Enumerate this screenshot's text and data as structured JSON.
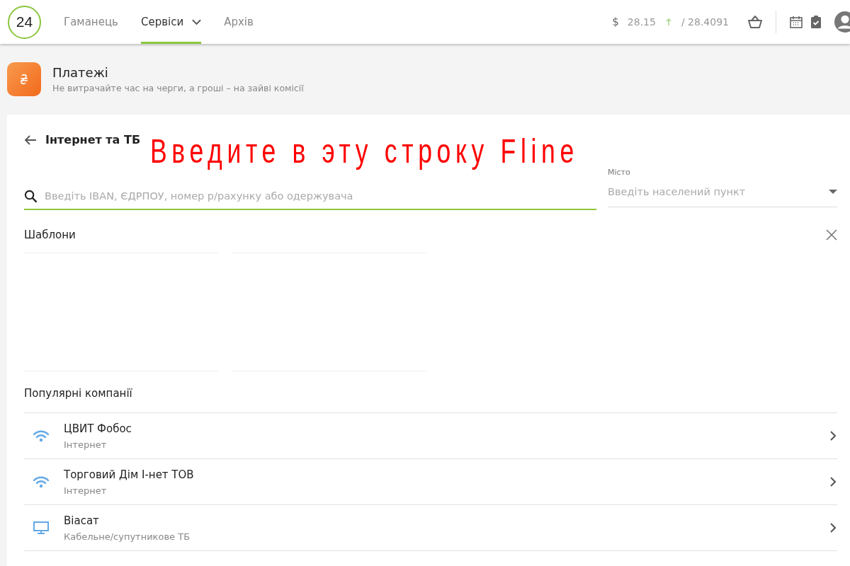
{
  "header": {
    "logo": "24",
    "nav": [
      {
        "label": "Гаманець",
        "selected": false,
        "dropdown": false
      },
      {
        "label": "Сервіси",
        "selected": true,
        "dropdown": true
      },
      {
        "label": "Архів",
        "selected": false,
        "dropdown": false
      }
    ],
    "currency": "$",
    "rate_buy": "28.15",
    "rate_sell": "/ 28.4091"
  },
  "section": {
    "title": "Платежі",
    "subtitle": "Не витрачайте час на черги, а гроші – на зайві комісії"
  },
  "annotation": "Введите в эту строку Fline",
  "page": {
    "title": "Інтернет та ТБ",
    "search": {
      "placeholder": "Введіть IBAN, ЄДРПОУ, номер р/рахунку або одержувача"
    },
    "city": {
      "label": "Місто",
      "placeholder": "Введіть населений пункт"
    }
  },
  "templates": {
    "title": "Шаблони"
  },
  "companies": {
    "title": "Популярні компанії",
    "items": [
      {
        "name": "ЦВИТ Фобос",
        "category": "Інтернет",
        "kind": "wifi"
      },
      {
        "name": "Торговий Дім І-нет ТОВ",
        "category": "Інтернет",
        "kind": "wifi"
      },
      {
        "name": "Віасат",
        "category": "Кабельне/супутникове ТБ",
        "kind": "tv"
      }
    ]
  }
}
